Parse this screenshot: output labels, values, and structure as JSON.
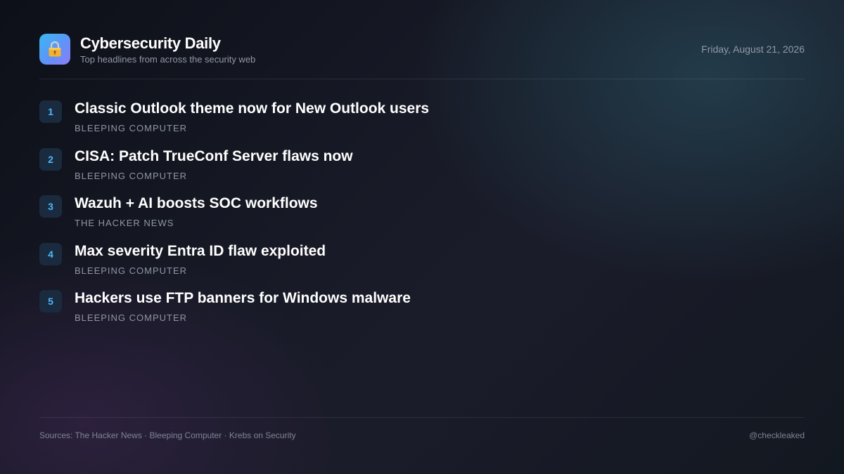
{
  "header": {
    "logo_icon": "padlock-icon",
    "title": "Cybersecurity Daily",
    "subtitle": "Top headlines from across the security web",
    "date": "Friday, August 21, 2026"
  },
  "colors": {
    "accent": "#4fb6f5",
    "badge_bg": "#1a2a3f",
    "logo_gradient_start": "#39b9f2",
    "logo_gradient_end": "#8d7df8"
  },
  "headlines": [
    {
      "rank": "1",
      "title": "Classic Outlook theme now for New Outlook users",
      "source": "Bleeping Computer"
    },
    {
      "rank": "2",
      "title": "CISA: Patch TrueConf Server flaws now",
      "source": "Bleeping Computer"
    },
    {
      "rank": "3",
      "title": "Wazuh + AI boosts SOC workflows",
      "source": "The Hacker News"
    },
    {
      "rank": "4",
      "title": "Max severity Entra ID flaw exploited",
      "source": "Bleeping Computer"
    },
    {
      "rank": "5",
      "title": "Hackers use FTP banners for Windows malware",
      "source": "Bleeping Computer"
    }
  ],
  "footer": {
    "sources": "Sources: The Hacker News · Bleeping Computer · Krebs on Security",
    "handle": "@checkleaked"
  }
}
